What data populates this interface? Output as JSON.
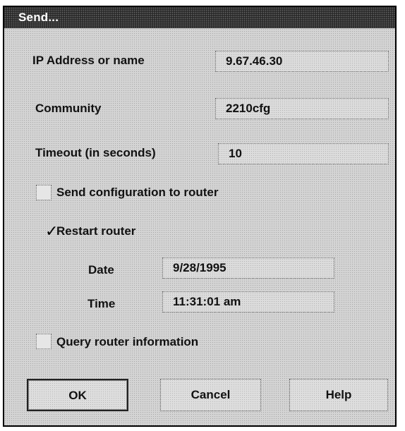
{
  "dialog": {
    "title": "Send..."
  },
  "fields": {
    "ip_label": "IP Address or name",
    "ip_value": "9.67.46.30",
    "community_label": "Community",
    "community_value": "2210cfg",
    "timeout_label": "Timeout  (in seconds)",
    "timeout_value": "10"
  },
  "options": {
    "send_config_label": "Send configuration to router",
    "send_config_checked": false,
    "restart_label": "Restart router",
    "restart_checked": true,
    "restart_check_glyph": "✓",
    "date_label": "Date",
    "date_value": "9/28/1995",
    "time_label": "Time",
    "time_value": "11:31:01 am",
    "query_label": "Query router information",
    "query_checked": false
  },
  "buttons": {
    "ok_label": "OK",
    "cancel_label": "Cancel",
    "help_label": "Help"
  }
}
